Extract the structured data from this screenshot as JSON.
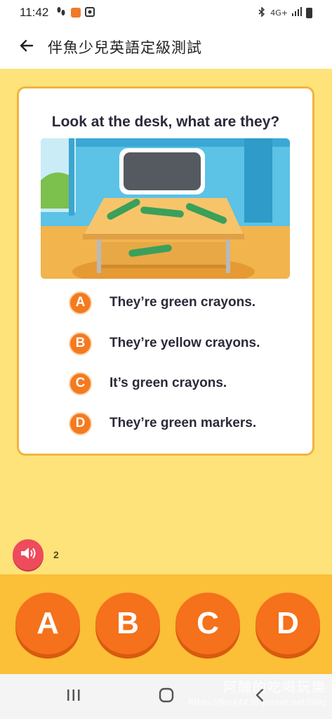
{
  "status_bar": {
    "time": "11:42",
    "network": "4G+"
  },
  "app_bar": {
    "title": "伴魚少兒英語定級測試"
  },
  "quiz": {
    "question": "Look at the desk, what are they?",
    "options": [
      {
        "letter": "A",
        "text": "They’re green crayons."
      },
      {
        "letter": "B",
        "text": "They’re yellow crayons."
      },
      {
        "letter": "C",
        "text": "It’s green crayons."
      },
      {
        "letter": "D",
        "text": "They’re green markers."
      }
    ]
  },
  "audio": {
    "play_count": "2"
  },
  "answer_buttons": [
    "A",
    "B",
    "C",
    "D"
  ],
  "watermark": {
    "line1": "阿醜的吃喝玩樂",
    "line2": "https://fnnk4438.pixnet.net/blog"
  },
  "colors": {
    "background": "#fde37a",
    "card_border": "#f2b33f",
    "option_badge": "#f47a1f",
    "answer_button": "#f5711b",
    "answer_tray": "#fbbf38",
    "audio_button": "#ee4b5d"
  },
  "icons": {
    "back": "arrow-left-icon",
    "audio": "speaker-icon",
    "nav_recent": "recent-apps-icon",
    "nav_home": "home-icon",
    "nav_back": "back-chevron-icon"
  }
}
